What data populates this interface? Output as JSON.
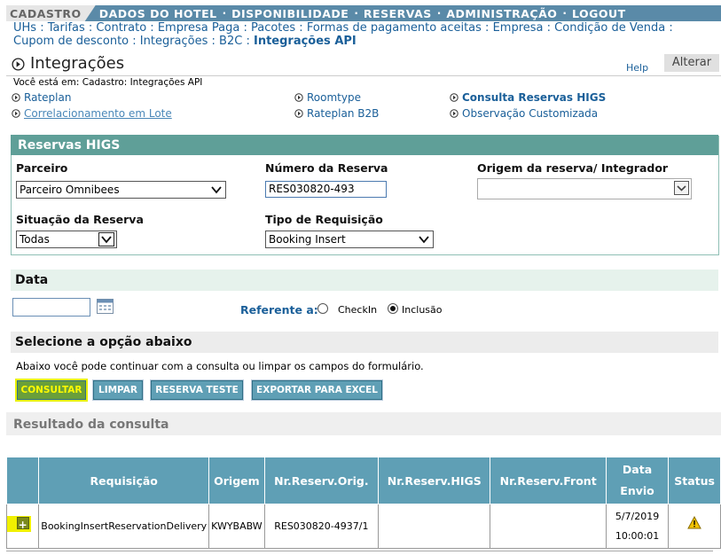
{
  "topnav": {
    "active": "CADASTRO",
    "items": [
      "DADOS DO HOTEL",
      "DISPONIBILIDADE",
      "RESERVAS",
      "ADMINISTRAÇÃO",
      "LOGOUT"
    ],
    "sep": "·"
  },
  "sublinks": [
    "UHs",
    "Tarifas",
    "Contrato",
    "Empresa Paga",
    "Pacotes",
    "Formas de pagamento aceitas",
    "Empresa",
    "Condição de Venda",
    "Cupom de desconto",
    "Integrações",
    "B2C",
    "Integrações API"
  ],
  "page": {
    "title": "Integrações",
    "help": "Help",
    "alterar": "Alterar",
    "breadcrumb": "Você está em: Cadastro: Integrações API"
  },
  "quicklinks": {
    "rateplan": "Rateplan",
    "roomtype": "Roomtype",
    "consulta": "Consulta Reservas HIGS",
    "correlacionamento": "Correlacionamento em Lote",
    "rateplan_b2b": "Rateplan B2B",
    "observacao": "Observação Customizada"
  },
  "form": {
    "heading": "Reservas HIGS",
    "parceiro_label": "Parceiro",
    "parceiro_value": "Parceiro Omnibees",
    "numero_label": "Número da Reserva",
    "numero_value": "RES030820-493",
    "origem_label": "Origem da reserva/ Integrador",
    "origem_value": "",
    "situacao_label": "Situação da Reserva",
    "situacao_value": "Todas",
    "tipo_label": "Tipo de Requisição",
    "tipo_value": "Booking Insert"
  },
  "data_section": {
    "heading": "Data",
    "date_value": "",
    "referente_label": "Referente a:",
    "opt_checkin": "CheckIn",
    "opt_inclusao": "Inclusão",
    "selected": "Inclusão"
  },
  "options": {
    "heading": "Selecione a opção abaixo",
    "description": "Abaixo você pode continuar com a consulta ou limpar os campos do formulário.",
    "btn_consultar": "CONSULTAR",
    "btn_limpar": "LIMPAR",
    "btn_teste": "RESERVA TESTE",
    "btn_excel": "EXPORTAR PARA EXCEL"
  },
  "results": {
    "heading": "Resultado da consulta",
    "columns": [
      "",
      "Requisição",
      "Origem",
      "Nr.Reserv.Orig.",
      "Nr.Reserv.HIGS",
      "Nr.Reserv.Front",
      "Data Envio",
      "Status"
    ],
    "rows": [
      {
        "requisicao": "BookingInsertReservationDelivery",
        "origem": "KWYBABW",
        "orig": "RES030820-4937/1",
        "higs": "",
        "front": "",
        "data_line1": "5/7/2019",
        "data_line2": "10:00:01",
        "status": "warning-icon"
      }
    ]
  }
}
